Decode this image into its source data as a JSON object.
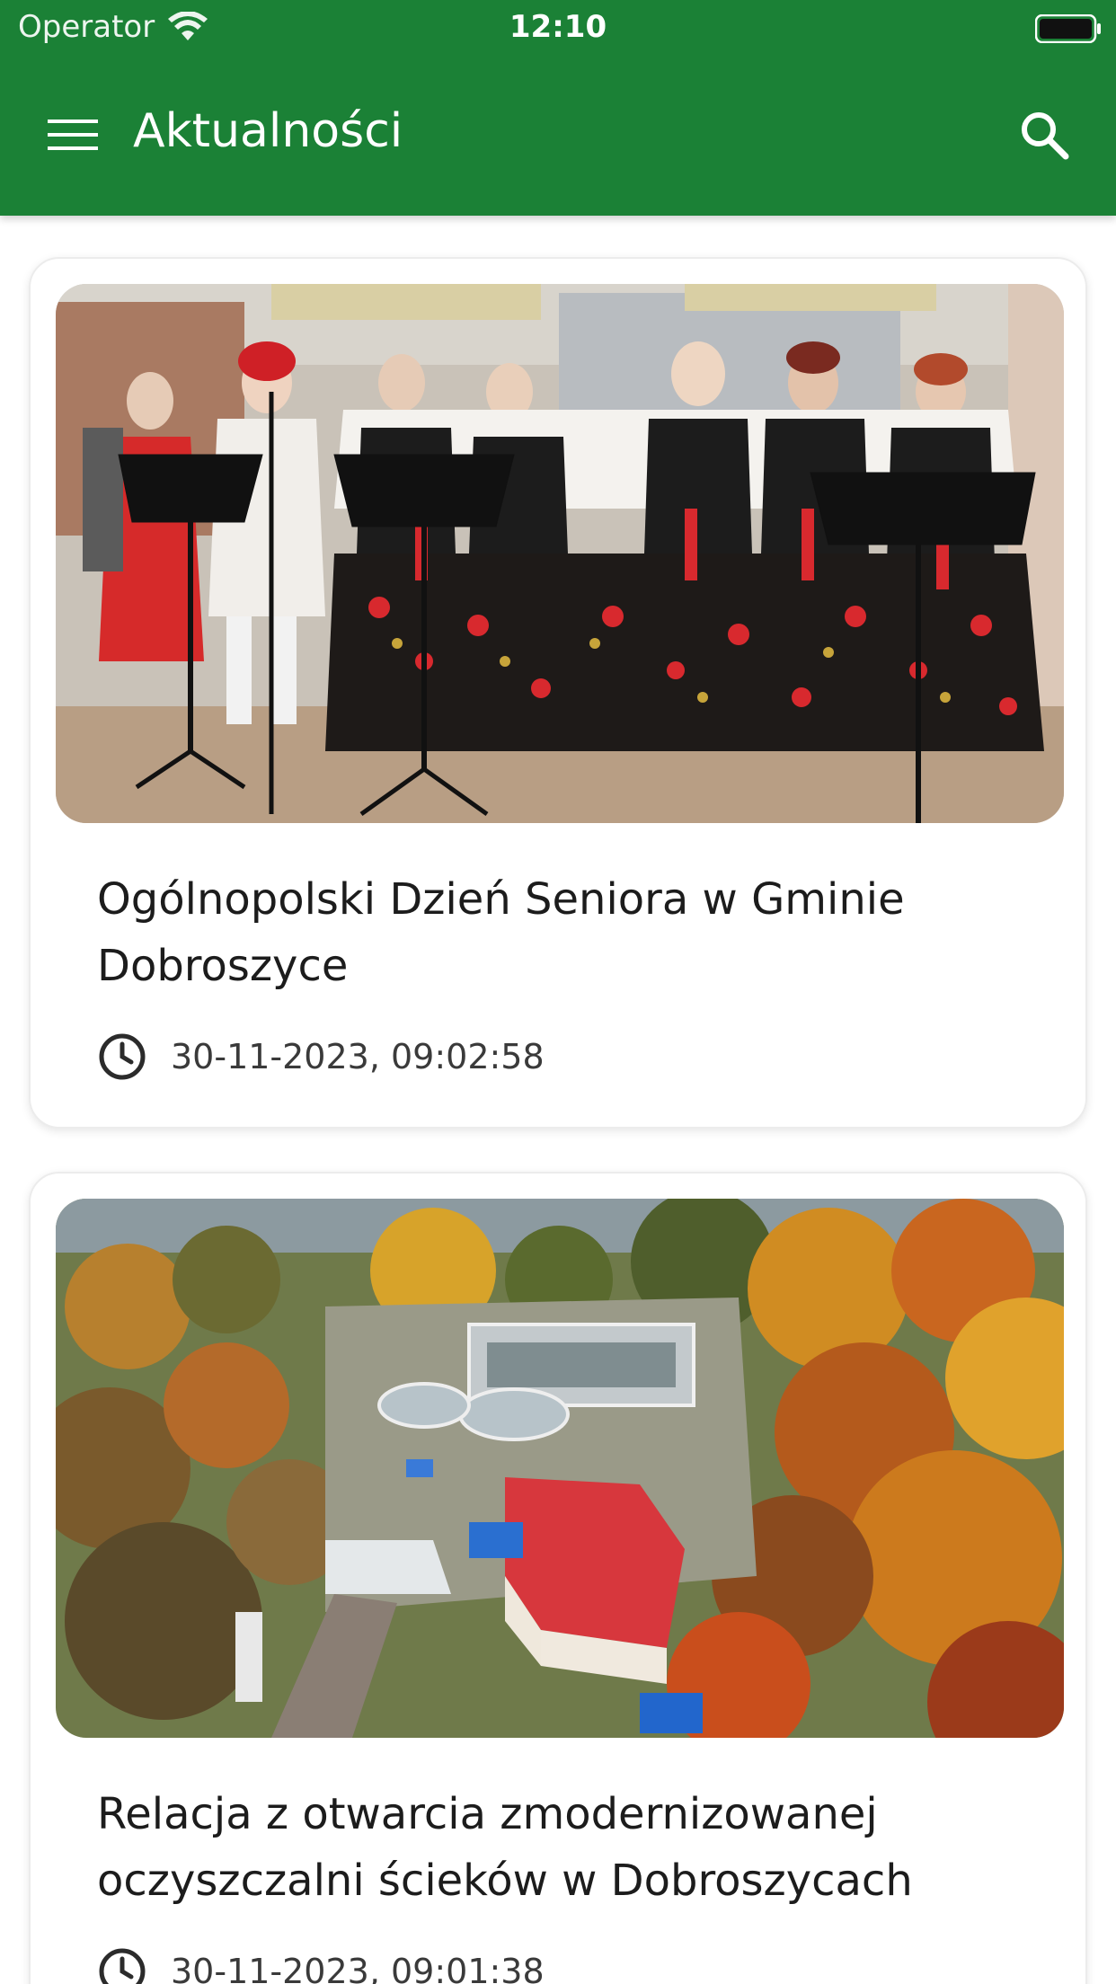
{
  "status_bar": {
    "carrier": "Operator",
    "time": "12:10"
  },
  "app_bar": {
    "title": "Aktualności",
    "menu_icon": "hamburger-menu-icon",
    "search_icon": "search-icon",
    "color": "#1b8136"
  },
  "articles": [
    {
      "title": "Ogólnopolski Dzień Seniora w Gminie Dobroszyce",
      "date": "30-11-2023, 09:02:58",
      "image": "folk-choir-photo"
    },
    {
      "title": "Relacja z otwarcia zmodernizowanej oczyszczalni ścieków w Dobroszycach",
      "date": "30-11-2023, 09:01:38",
      "image": "aerial-treatment-plant-photo"
    }
  ]
}
